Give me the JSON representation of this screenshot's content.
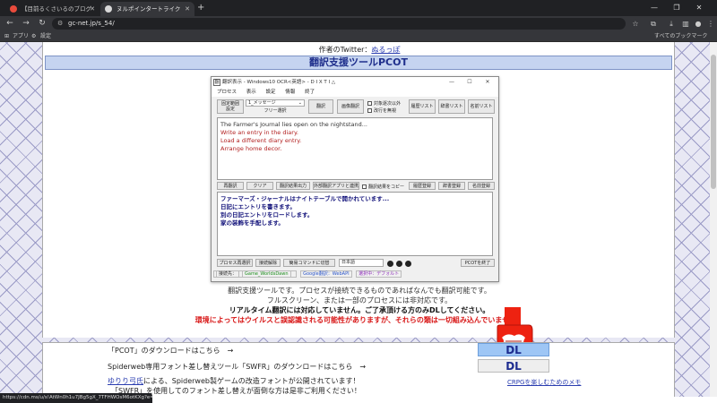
{
  "browser": {
    "tabs": [
      {
        "title": "【目前るくさいるのブログ",
        "active": false
      },
      {
        "title": "ヌルポインタートライク",
        "active": true
      }
    ],
    "url": "gc-net.jp/s_54/",
    "bookmarks": [
      "アプリ",
      "設定"
    ],
    "all_bookmarks": "すべてのブックマーク",
    "status_url": "https://cdn.ms/u/s!AtWn0h1u7JBg5gX_7TFHWOsM6otKXg?e=Ys56Pz"
  },
  "page": {
    "author_label": "作者のTwitter：",
    "author_link": "ぬるっぽ",
    "title": "翻訳支援ツールPCOT",
    "descriptions": [
      "翻訳支援ツールです。プロセスが接続できるものであればなんでも翻訳可能です。",
      "フルスクリーン、または一部のプロセスには非対応です。",
      "リアルタイム翻訳には対応していません。ご了承頂ける方のみDLしてください。",
      "環境によってはウイルスと誤認識される可能性がありますが、それらの類は一切組み込んでいません。"
    ]
  },
  "app": {
    "title": "翻訳表示 - Windows10 OCR<英語> - D I X T I △",
    "menu": [
      "プロセス",
      "表示",
      "設定",
      "情報",
      "終了"
    ],
    "buttons_top": {
      "fix": "固定範囲\n設定",
      "select_value": "1_メッセージ",
      "free_select": "フリー選択",
      "translate": "翻訳",
      "image_translate": "画像翻訳",
      "history": "履歴リスト",
      "dictionary": "辞書リスト",
      "names": "名前リスト"
    },
    "checkboxes": [
      "対象逐次以外",
      "改行を無視"
    ],
    "source_lines": [
      "The Farmer's Journal lies open on the nightstand...",
      "Write an entry in the diary.",
      "Load a different diary entry.",
      "Arrange home decor."
    ],
    "buttons_mid": {
      "retranslate": "再翻訳",
      "clear": "クリア",
      "output": "翻訳結果出力",
      "external": "外部翻訳アプリと連携",
      "copy": "翻訳結果をコピー",
      "history_reg": "履歴登録",
      "dict_reg": "辞書登録",
      "name_reg": "名前登録"
    },
    "output_lines": [
      "ファーマーズ・ジャーナルはナイトテーブルで開かれています...",
      "日記にエントリを書きます。",
      "別の日記エントリをロードします。",
      "家の装飾を手配します。"
    ],
    "buttons_bottom": {
      "process_reselect": "プロセス再選択",
      "connect_release": "接続解除",
      "simple_command": "簡易コマンドに切替",
      "language": "日本語",
      "end": "PCOTを終了"
    },
    "status": {
      "target": "接続先：",
      "process": "Game_WorldsDawn",
      "engine": "Google翻訳：WebAPI",
      "mode": "選択中：デフォルト"
    }
  },
  "lower": {
    "pcot_dl": "「PCOT」のダウンロードはこちら　→",
    "swfr_dl": "Spiderweb専用フォント差し替えツール「SWFR」のダウンロードはこちら　→",
    "note_link": "ゆりり弓氏",
    "note_text": "による、Spiderweb製ゲームの改造フォントが公開されています！",
    "note_text2": "「SWFR」を使用してのフォント差し替えが面倒な方は是非ご利用ください！",
    "dl1": "DL",
    "dl2": "DL",
    "crpg_link": "CRPGを楽しむためのメモ"
  }
}
